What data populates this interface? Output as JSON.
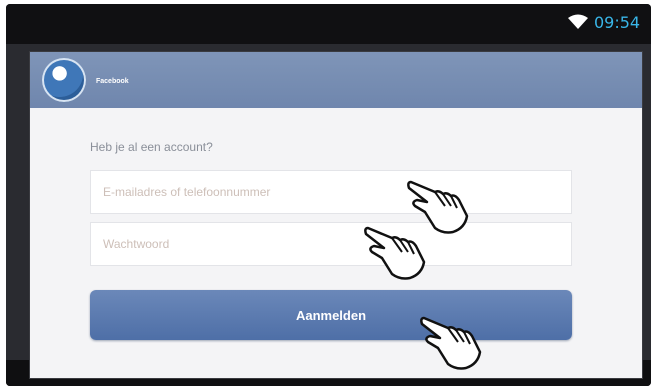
{
  "status_bar": {
    "time": "09:54",
    "wifi_icon": "wifi-icon"
  },
  "dialog": {
    "title": "Facebook",
    "app_icon": "facebook-contact-icon",
    "question": "Heb je al een account?",
    "email_placeholder": "E-mailadres of telefoonnummer",
    "password_placeholder": "Wachtwoord",
    "login_label": "Aanmelden"
  },
  "pointer_icons": [
    "hand-pointer-icon",
    "hand-pointer-icon",
    "hand-pointer-icon"
  ],
  "colors": {
    "header": "#7a90b6",
    "button": "#5a79af",
    "time": "#39b6e8"
  }
}
